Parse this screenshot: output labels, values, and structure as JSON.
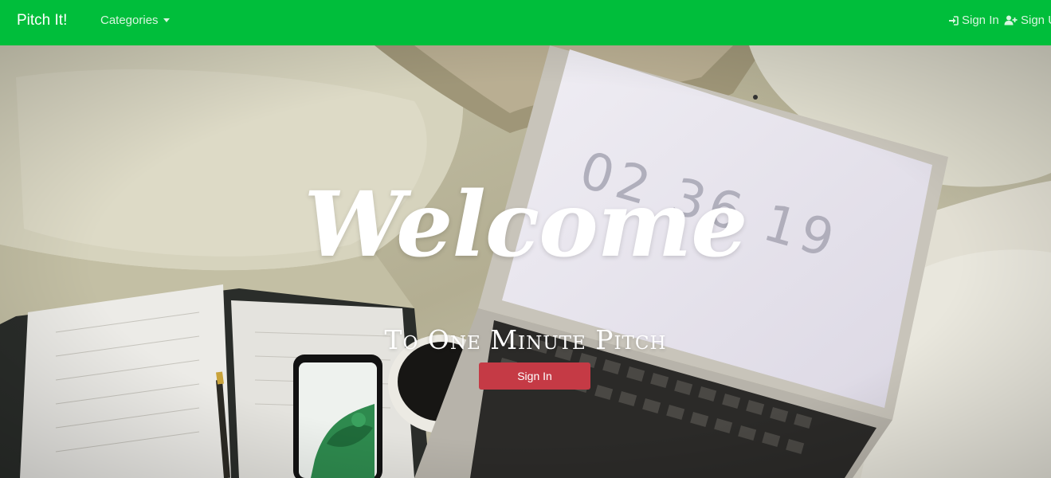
{
  "navbar": {
    "brand": "Pitch It!",
    "categories_label": "Categories",
    "sign_in_label": "Sign In",
    "sign_up_label": "Sign Up",
    "bg_color": "#00be3b"
  },
  "hero": {
    "title": "Welcome",
    "subtitle": "To One Minute Pitch",
    "button_label": "Sign In",
    "button_color": "#c53a45",
    "laptop_clock": [
      "02",
      "36",
      "19"
    ]
  },
  "icons": {
    "sign_in": "sign-in-icon",
    "sign_up": "user-plus-icon"
  }
}
